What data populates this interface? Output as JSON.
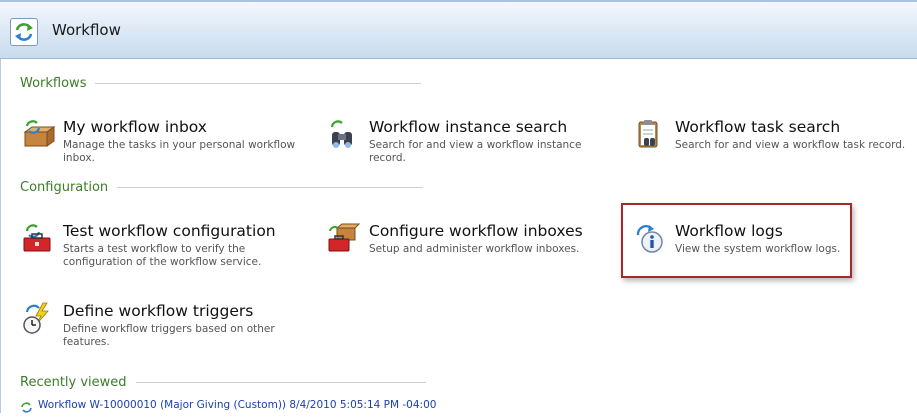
{
  "header": {
    "title": "Workflow",
    "icon": "workflow-icon"
  },
  "sections": {
    "workflows": "Workflows",
    "configuration": "Configuration",
    "recent": "Recently viewed"
  },
  "tasks": {
    "inbox": {
      "title": "My workflow inbox",
      "desc": "Manage the tasks in your personal workflow inbox.",
      "icon": "inbox-icon"
    },
    "instance_search": {
      "title": "Workflow instance search",
      "desc": "Search for and view a workflow instance record.",
      "icon": "binoculars-icon"
    },
    "task_search": {
      "title": "Workflow task search",
      "desc": "Search for and view a workflow task record.",
      "icon": "clipboard-icon"
    },
    "test_config": {
      "title": "Test workflow configuration",
      "desc": "Starts a test workflow to verify the configuration of the workflow service.",
      "icon": "toolbox-icon"
    },
    "configure_inboxes": {
      "title": "Configure workflow inboxes",
      "desc": "Setup and administer workflow inboxes.",
      "icon": "configure-inbox-icon"
    },
    "logs": {
      "title": "Workflow logs",
      "desc": "View the system workflow logs.",
      "icon": "info-icon"
    },
    "triggers": {
      "title": "Define workflow triggers",
      "desc": "Define workflow triggers based on other features.",
      "icon": "lightning-clock-icon"
    }
  },
  "recent": [
    {
      "label": "Workflow W-10000010 (Major Giving (Custom)) 8/4/2010 5:05:14 PM -04:00",
      "icon": "workflow-small-icon"
    }
  ],
  "colors": {
    "section": "#3b7d28",
    "link": "#1a3fb0",
    "highlight": "#a8272a"
  }
}
